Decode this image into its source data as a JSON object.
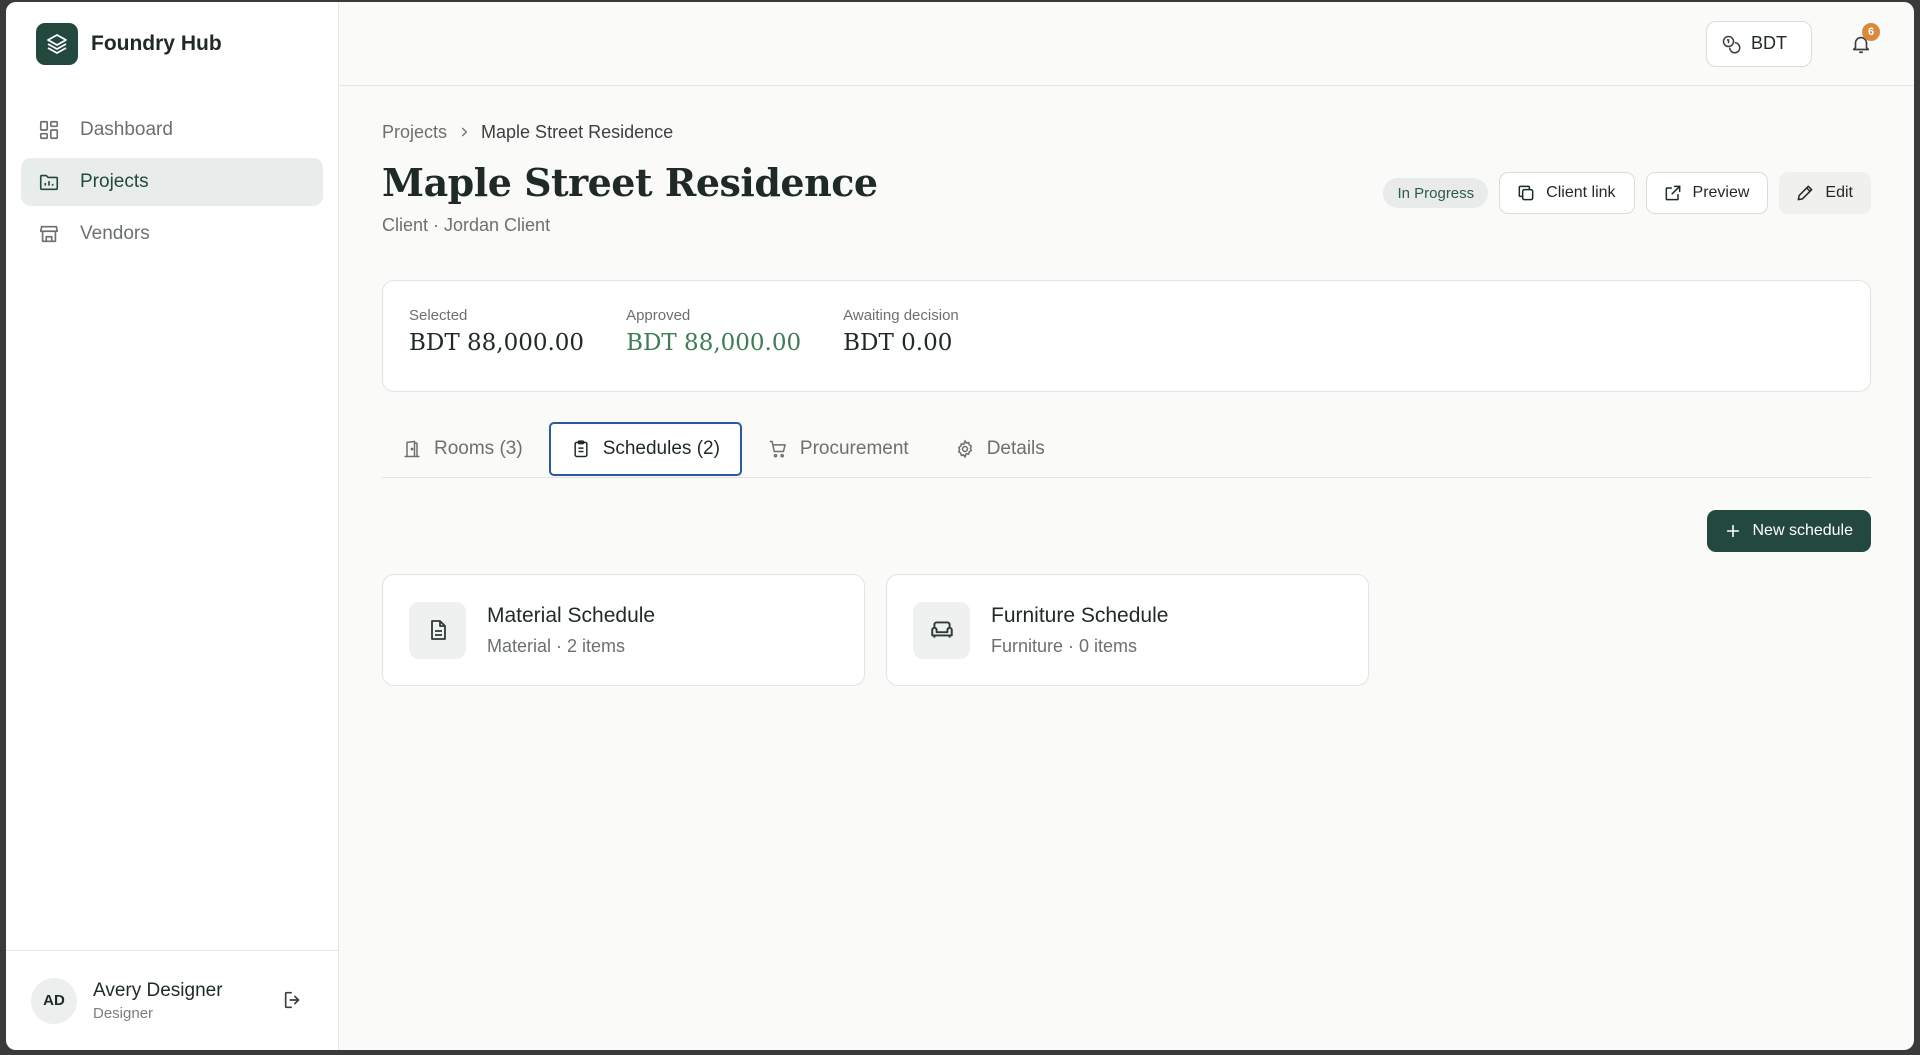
{
  "brand": {
    "name": "Foundry Hub",
    "logo_icon": "layers-icon",
    "accent": "#23493f"
  },
  "sidebar": {
    "items": [
      {
        "label": "Dashboard",
        "icon": "dashboard-icon",
        "active": false
      },
      {
        "label": "Projects",
        "icon": "folder-chart-icon",
        "active": true
      },
      {
        "label": "Vendors",
        "icon": "store-icon",
        "active": false
      }
    ],
    "user": {
      "initials": "AD",
      "name": "Avery Designer",
      "role": "Designer"
    }
  },
  "topbar": {
    "currency_label": "BDT",
    "notifications_count": "6",
    "badge_color": "#d98a3d"
  },
  "breadcrumb": {
    "parent": "Projects",
    "current": "Maple Street Residence"
  },
  "project": {
    "title": "Maple Street Residence",
    "subtitle": "Client · Jordan Client",
    "status": "In Progress"
  },
  "actions": {
    "client_link": "Client link",
    "preview": "Preview",
    "edit": "Edit"
  },
  "summary": {
    "selected_label": "Selected",
    "selected_value": "BDT 88,000.00",
    "approved_label": "Approved",
    "approved_value": "BDT 88,000.00",
    "awaiting_label": "Awaiting decision",
    "awaiting_value": "BDT 0.00"
  },
  "tabs": [
    {
      "label": "Rooms (3)",
      "icon": "door-icon",
      "active": false
    },
    {
      "label": "Schedules (2)",
      "icon": "clipboard-icon",
      "active": true
    },
    {
      "label": "Procurement",
      "icon": "cart-icon",
      "active": false
    },
    {
      "label": "Details",
      "icon": "gear-icon",
      "active": false
    }
  ],
  "toolbar": {
    "new_schedule": "New schedule"
  },
  "schedules": [
    {
      "title": "Material Schedule",
      "subtitle": "Material · 2 items",
      "icon": "document-icon"
    },
    {
      "title": "Furniture Schedule",
      "subtitle": "Furniture · 0 items",
      "icon": "sofa-icon"
    }
  ]
}
